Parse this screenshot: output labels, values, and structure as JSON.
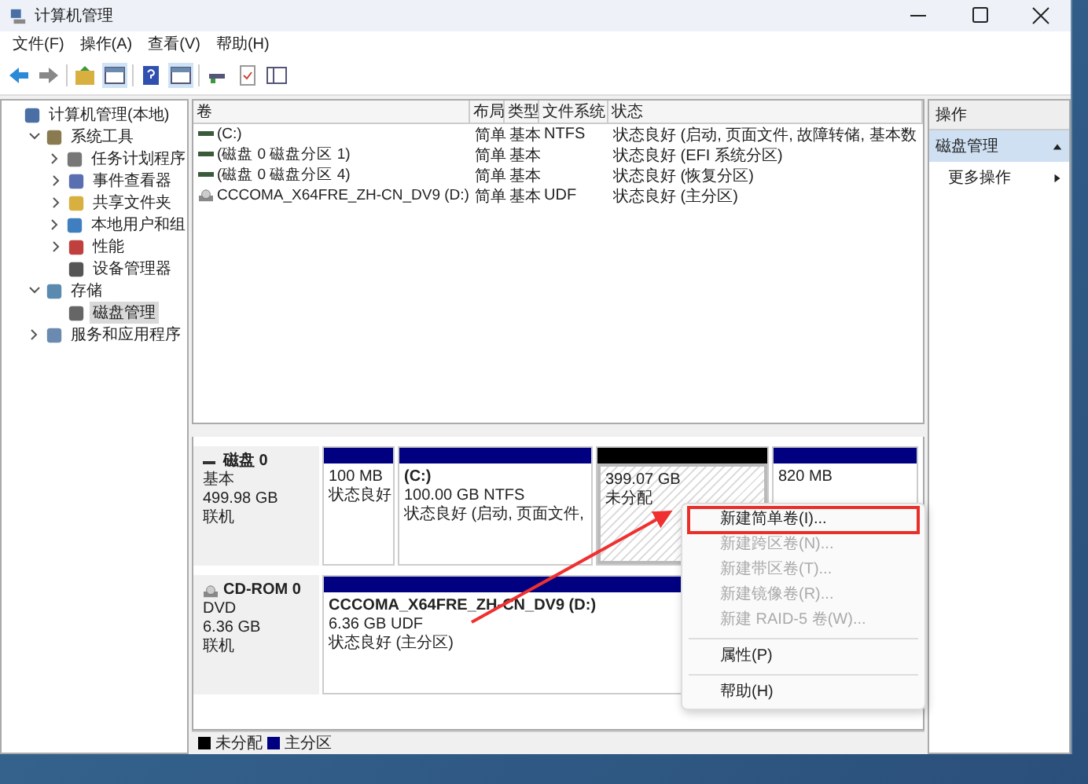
{
  "window": {
    "title": "计算机管理"
  },
  "menu_bar": [
    "文件(F)",
    "操作(A)",
    "查看(V)",
    "帮助(H)"
  ],
  "tree": [
    {
      "label": "计算机管理(本地)",
      "selected": false,
      "children": [
        {
          "label": "系统工具",
          "expanded": true,
          "selected": false,
          "children": [
            {
              "label": "任务计划程序",
              "expanded": false,
              "selected": false
            },
            {
              "label": "事件查看器",
              "expanded": false,
              "selected": false
            },
            {
              "label": "共享文件夹",
              "expanded": false,
              "selected": false
            },
            {
              "label": "本地用户和组",
              "expanded": false,
              "selected": false
            },
            {
              "label": "性能",
              "expanded": false,
              "selected": false
            },
            {
              "label": "设备管理器",
              "selected": false
            }
          ]
        },
        {
          "label": "存储",
          "expanded": true,
          "selected": false,
          "children": [
            {
              "label": "磁盘管理",
              "selected": true
            }
          ]
        },
        {
          "label": "服务和应用程序",
          "expanded": false,
          "selected": false
        }
      ]
    }
  ],
  "volume_table": {
    "columns": [
      "卷",
      "布局",
      "类型",
      "文件系统",
      "状态"
    ],
    "rows": [
      {
        "kind": "disk",
        "cells": [
          "(C:)",
          "简单",
          "基本",
          "NTFS",
          "状态良好 (启动, 页面文件, 故障转储, 基本数"
        ]
      },
      {
        "kind": "disk",
        "cells": [
          "(磁盘 0 磁盘分区 1)",
          "简单",
          "基本",
          "",
          "状态良好 (EFI 系统分区)"
        ]
      },
      {
        "kind": "disk",
        "cells": [
          "(磁盘 0 磁盘分区 4)",
          "简单",
          "基本",
          "",
          "状态良好 (恢复分区)"
        ]
      },
      {
        "kind": "optical",
        "cells": [
          "CCCOMA_X64FRE_ZH-CN_DV9 (D:)",
          "简单",
          "基本",
          "UDF",
          "状态良好 (主分区)"
        ]
      }
    ]
  },
  "disks": [
    {
      "kind": "disk",
      "name": "磁盘 0",
      "type": "基本",
      "size": "499.98 GB",
      "status": "联机",
      "partitions": [
        {
          "kind": "primary",
          "lines": [
            "100 MB",
            "状态良好"
          ]
        },
        {
          "kind": "primary",
          "title": "(C:)",
          "lines": [
            "100.00 GB NTFS",
            "状态良好 (启动, 页面文件,"
          ]
        },
        {
          "kind": "unallocated",
          "lines": [
            "399.07 GB",
            "未分配"
          ]
        },
        {
          "kind": "primary",
          "lines": [
            "820 MB"
          ]
        }
      ]
    },
    {
      "kind": "optical",
      "name": "CD-ROM 0",
      "type": "DVD",
      "size": "6.36 GB",
      "status": "联机",
      "partitions": [
        {
          "kind": "primary",
          "title": "CCCOMA_X64FRE_ZH-CN_DV9  (D:)",
          "lines": [
            "6.36 GB UDF",
            "状态良好 (主分区)"
          ]
        }
      ]
    }
  ],
  "legend": [
    {
      "label": "未分配",
      "color": "#000000"
    },
    {
      "label": "主分区",
      "color": "#000080"
    }
  ],
  "actions": {
    "header": "操作",
    "section": "磁盘管理",
    "items": [
      "更多操作"
    ]
  },
  "context_menu": [
    [
      {
        "label": "新建简单卷(I)...",
        "disabled": false,
        "highlighted": true
      },
      {
        "label": "新建跨区卷(N)...",
        "disabled": true,
        "highlighted": false
      },
      {
        "label": "新建带区卷(T)...",
        "disabled": true,
        "highlighted": false
      },
      {
        "label": "新建镜像卷(R)...",
        "disabled": true,
        "highlighted": false
      },
      {
        "label": "新建 RAID-5 卷(W)...",
        "disabled": true,
        "highlighted": false
      }
    ],
    [
      {
        "label": "属性(P)",
        "disabled": false,
        "highlighted": false
      }
    ],
    [
      {
        "label": "帮助(H)",
        "disabled": false,
        "highlighted": false
      }
    ]
  ]
}
